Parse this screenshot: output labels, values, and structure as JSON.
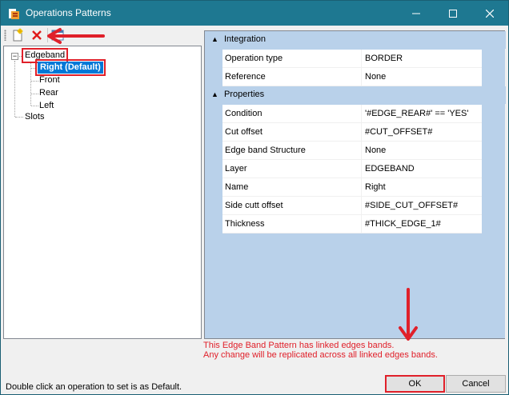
{
  "window": {
    "title": "Operations Patterns",
    "accent_color": "#1e7891"
  },
  "titlebar_buttons": {
    "minimize_icon": "minimize-icon",
    "maximize_icon": "maximize-icon",
    "close_icon": "close-icon"
  },
  "toolbar": {
    "new_icon": "new-document-icon",
    "delete_icon": "delete-x-icon"
  },
  "tree": {
    "root_expander": "−",
    "root": "Edgeband",
    "children": [
      "Right (Default)",
      "Front",
      "Rear",
      "Left"
    ],
    "sibling": "Slots"
  },
  "properties": {
    "categories": [
      {
        "label": "Integration",
        "rows": [
          {
            "name": "Operation type",
            "value": "BORDER"
          },
          {
            "name": "Reference",
            "value": "None"
          }
        ]
      },
      {
        "label": "Properties",
        "rows": [
          {
            "name": "Condition",
            "value": "'#EDGE_REAR#' == 'YES'"
          },
          {
            "name": "Cut offset",
            "value": "#CUT_OFFSET#"
          },
          {
            "name": "Edge band Structure",
            "value": "None"
          },
          {
            "name": "Layer",
            "value": "EDGEBAND"
          },
          {
            "name": "Name",
            "value": "Right"
          },
          {
            "name": "Side cutt offset",
            "value": "#SIDE_CUT_OFFSET#"
          },
          {
            "name": "Thickness",
            "value": "#THICK_EDGE_1#"
          }
        ]
      }
    ]
  },
  "warning": {
    "line1": "This Edge Band Pattern has linked edges bands.",
    "line2": "Any change will be replicated across all linked edges bands."
  },
  "status": "Double click an operation to set is as Default.",
  "buttons": {
    "ok": "OK",
    "cancel": "Cancel"
  },
  "annotation_color": "#e0202a"
}
